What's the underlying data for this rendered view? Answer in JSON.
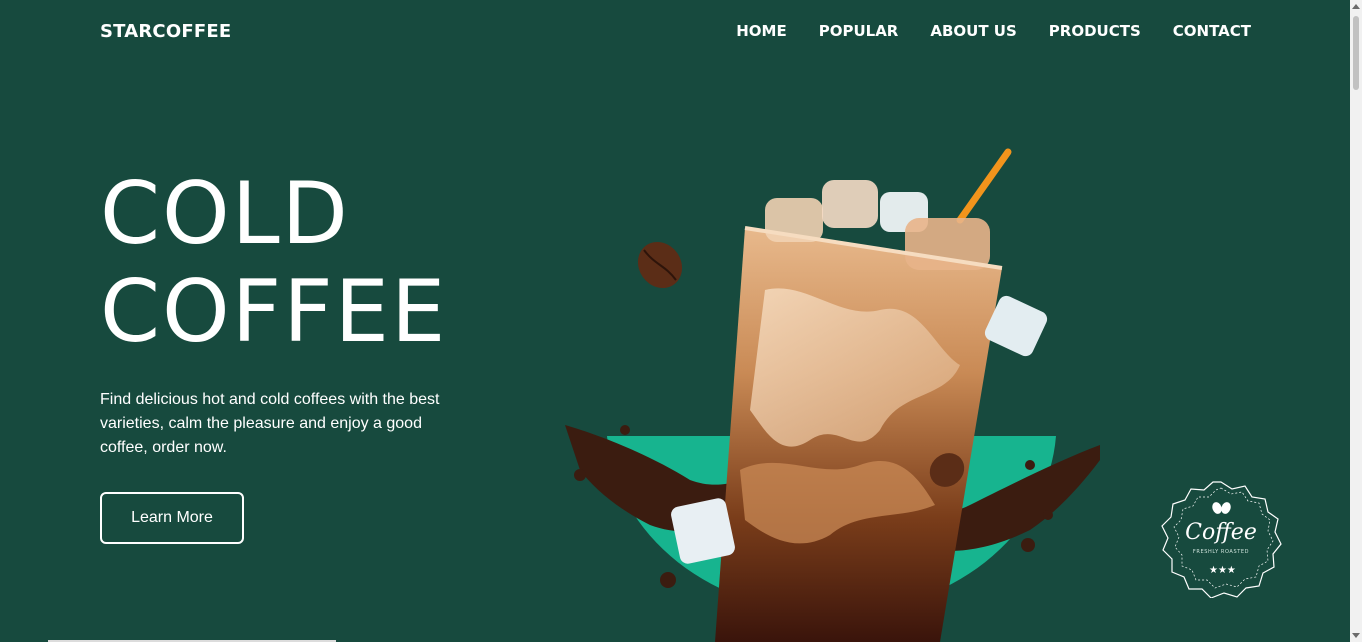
{
  "brand": {
    "name": "STARCOFFEE"
  },
  "nav": {
    "items": [
      {
        "label": "HOME"
      },
      {
        "label": "POPULAR"
      },
      {
        "label": "ABOUT US"
      },
      {
        "label": "PRODUCTS"
      },
      {
        "label": "CONTACT"
      }
    ]
  },
  "hero": {
    "title_line1": "COLD",
    "title_line2": "COFFEE",
    "description": "Find delicious hot and cold coffees with the best varieties, calm the pleasure and enjoy a good coffee, order now.",
    "button_label": "Learn More",
    "image_icon": "iced-coffee-glass-image"
  },
  "badge": {
    "text": "Coffee",
    "subtext": "FRESHLY ROASTED",
    "icon": "coffee-bean-icon"
  },
  "colors": {
    "background": "#174a3e",
    "accent": "#17b48f",
    "text": "#ffffff"
  }
}
